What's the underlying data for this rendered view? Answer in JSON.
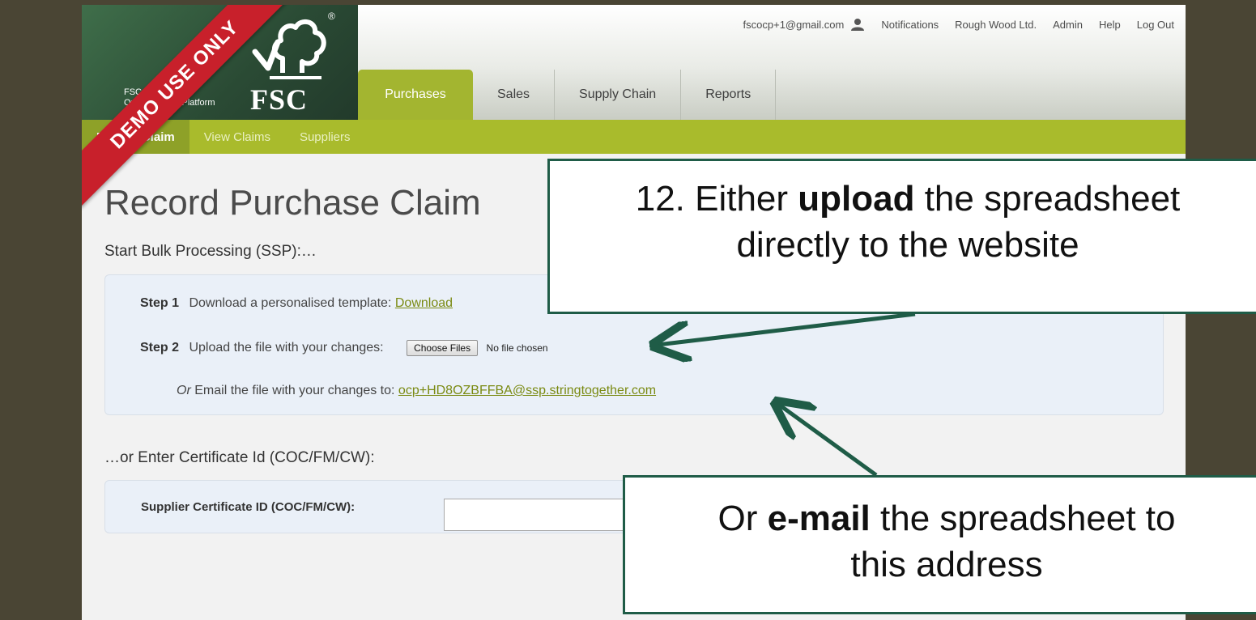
{
  "header": {
    "platform_line1": "FSC International",
    "platform_line2": "Online Claims Platform",
    "logo_text": "FSC",
    "registered_mark": "®",
    "top_links": {
      "email": "fscocp+1@gmail.com",
      "notifications": "Notifications",
      "company": "Rough Wood Ltd.",
      "admin": "Admin",
      "help": "Help",
      "logout": "Log Out"
    }
  },
  "nav": {
    "tabs": [
      {
        "label": "Purchases",
        "active": true
      },
      {
        "label": "Sales",
        "active": false
      },
      {
        "label": "Supply Chain",
        "active": false
      },
      {
        "label": "Reports",
        "active": false
      }
    ]
  },
  "subnav": {
    "items": [
      {
        "label": "Record Claim",
        "active": true
      },
      {
        "label": "View Claims",
        "active": false
      },
      {
        "label": "Suppliers",
        "active": false
      }
    ]
  },
  "main": {
    "title": "Record Purchase Claim",
    "ssp_heading": "Start Bulk Processing (SSP):…",
    "step1": {
      "label": "Step 1",
      "text": "Download a personalised template:",
      "link": "Download"
    },
    "step2": {
      "label": "Step 2",
      "text": "Upload the file with your changes:",
      "button": "Choose Files",
      "status": "No file chosen"
    },
    "email": {
      "or": "Or",
      "text": "Email the file with your changes to:",
      "address": "ocp+HD8OZBFFBA@ssp.stringtogether.com"
    },
    "cert_heading": "…or Enter Certificate Id (COC/FM/CW):",
    "cert_label": "Supplier Certificate ID (COC/FM/CW):",
    "cert_value": ""
  },
  "overlay": {
    "ribbon": "DEMO USE ONLY",
    "callout_upload": {
      "prefix": "12. Either ",
      "bold": "upload",
      "suffix": " the spreadsheet",
      "line2": "directly to the website"
    },
    "callout_email": {
      "prefix": "Or ",
      "bold": "e-mail",
      "suffix": " the spreadsheet to",
      "line2": "this address"
    }
  },
  "colors": {
    "frame": "#4a4534",
    "logo_green": "#2a4a34",
    "tab_active": "#a3b530",
    "subnav": "#a9bb2c",
    "link": "#7a8a12",
    "callout_border": "#1f5c47",
    "ribbon": "#c8202b"
  },
  "icons": {
    "user": "user-icon",
    "logo": "fsc-tree-checkmark-logo"
  }
}
